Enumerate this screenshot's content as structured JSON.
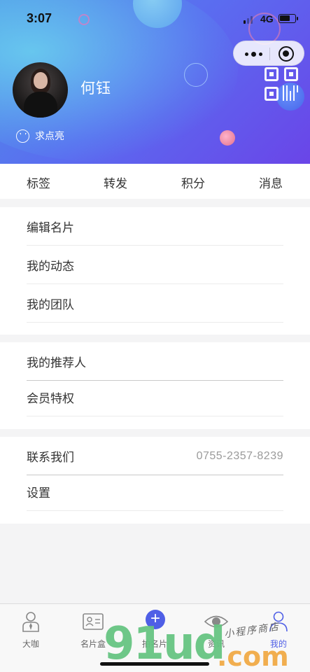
{
  "status_bar": {
    "time": "3:07",
    "network": "4G"
  },
  "profile": {
    "name": "何钰",
    "like_label": "求点亮"
  },
  "stats_tabs": [
    {
      "label": "标签"
    },
    {
      "label": "转发"
    },
    {
      "label": "积分"
    },
    {
      "label": "消息"
    }
  ],
  "menu": {
    "group1": [
      {
        "label": "编辑名片"
      },
      {
        "label": "我的动态"
      },
      {
        "label": "我的团队"
      }
    ],
    "group2": [
      {
        "label": "我的推荐人"
      },
      {
        "label": "会员特权"
      }
    ],
    "group3": [
      {
        "label": "联系我们",
        "value": "0755-2357-8239"
      },
      {
        "label": "设置"
      }
    ]
  },
  "tabbar": [
    {
      "label": "大咖",
      "icon": "person-tie-icon"
    },
    {
      "label": "名片盒",
      "icon": "card-box-icon"
    },
    {
      "label": "拍名片",
      "icon": "plus-icon"
    },
    {
      "label": "资讯",
      "icon": "eye-icon"
    },
    {
      "label": "我的",
      "icon": "user-icon",
      "active": true
    }
  ],
  "watermark": {
    "main": "91ud",
    "suffix": ".com",
    "cn": "小程序商店"
  },
  "colors": {
    "accent": "#4f5fe6",
    "header_start": "#4d93e6",
    "header_end": "#6a45e8"
  }
}
